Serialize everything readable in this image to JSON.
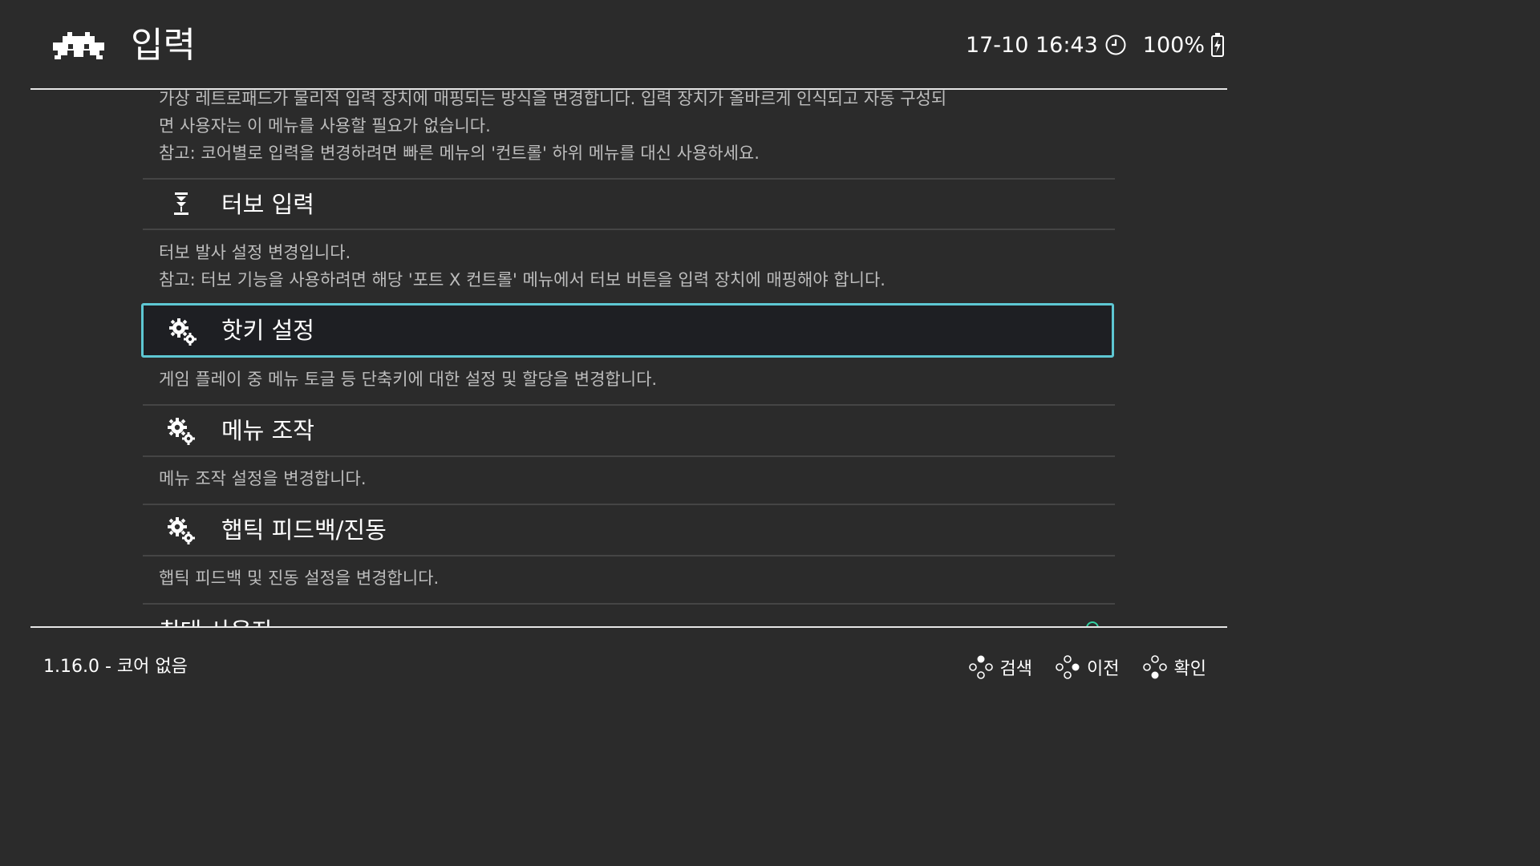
{
  "header": {
    "title": "입력",
    "datetime": "17-10 16:43",
    "battery": "100%"
  },
  "intro_description": {
    "line1": "가상 레트로패드가 물리적 입력 장치에 매핑되는 방식을 변경합니다. 입력 장치가 올바르게 인식되고 자동 구성되",
    "line2": "면 사용자는 이 메뉴를 사용할 필요가 없습니다.",
    "line3": "참고: 코어별로 입력을 변경하려면 빠른 메뉴의 '컨트롤' 하위 메뉴를 대신 사용하세요."
  },
  "menu": {
    "items": [
      {
        "label": "터보 입력",
        "icon": "turbo-icon",
        "description_line1": "터보 발사 설정 변경입니다.",
        "description_line2": "참고: 터보 기능을 사용하려면 해당 '포트 X 컨트롤' 메뉴에서 터보 버튼을 입력 장치에 매핑해야 합니다."
      },
      {
        "label": "핫키 설정",
        "icon": "gears-icon",
        "selected": true,
        "description_line1": "게임 플레이 중 메뉴 토글 등 단축키에 대한 설정 및 할당을 변경합니다."
      },
      {
        "label": "메뉴 조작",
        "icon": "gears-icon",
        "description_line1": "메뉴 조작 설정을 변경합니다."
      },
      {
        "label": "햅틱 피드백/진동",
        "icon": "gears-icon",
        "description_line1": "햅틱 피드백 및 진동 설정을 변경합니다."
      }
    ],
    "partial_item_label": "최대 사용자"
  },
  "footer": {
    "version": "1.16.0 - 코어 없음",
    "actions": [
      {
        "label": "검색",
        "icon": "gamepad-top-button-icon"
      },
      {
        "label": "이전",
        "icon": "gamepad-right-button-icon"
      },
      {
        "label": "확인",
        "icon": "gamepad-bottom-button-icon"
      }
    ]
  },
  "colors": {
    "background": "#2b2b2b",
    "selection_border": "#5ec7d3",
    "selection_fill": "#1e1f23",
    "description_text": "#bdbdbd",
    "separator": "#454545",
    "toggle_accent": "#33d1a3"
  }
}
